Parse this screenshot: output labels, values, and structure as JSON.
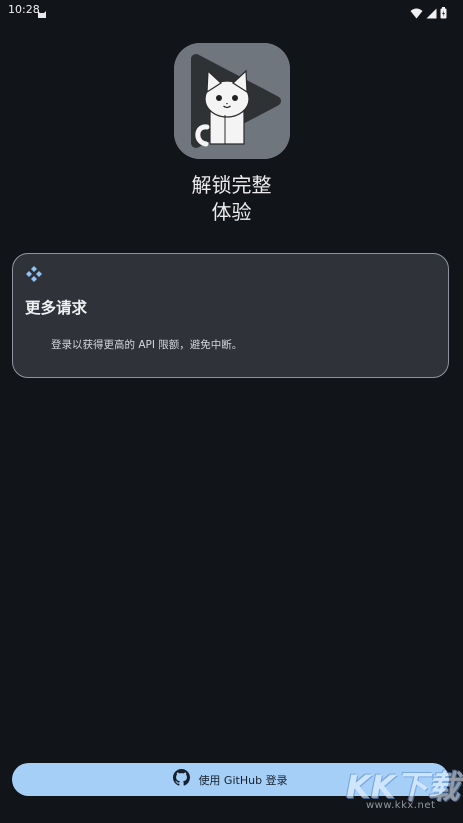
{
  "status": {
    "time": "10:28"
  },
  "app": {
    "title_line1": "解锁完整",
    "title_line2": "体验"
  },
  "card": {
    "title": "更多请求",
    "description": "登录以获得更高的 API 限额，避免中断。"
  },
  "login": {
    "label": "使用 GitHub 登录"
  },
  "watermark": {
    "text": "KK下载",
    "url": "www.kkx.net"
  },
  "colors": {
    "background": "#111418",
    "card": "#2f3238",
    "accent": "#a6cff8"
  },
  "icons": [
    "notification-cat-icon",
    "wifi-icon",
    "signal-icon",
    "battery-icon",
    "app-logo-icon",
    "diamond-icon",
    "github-icon"
  ]
}
